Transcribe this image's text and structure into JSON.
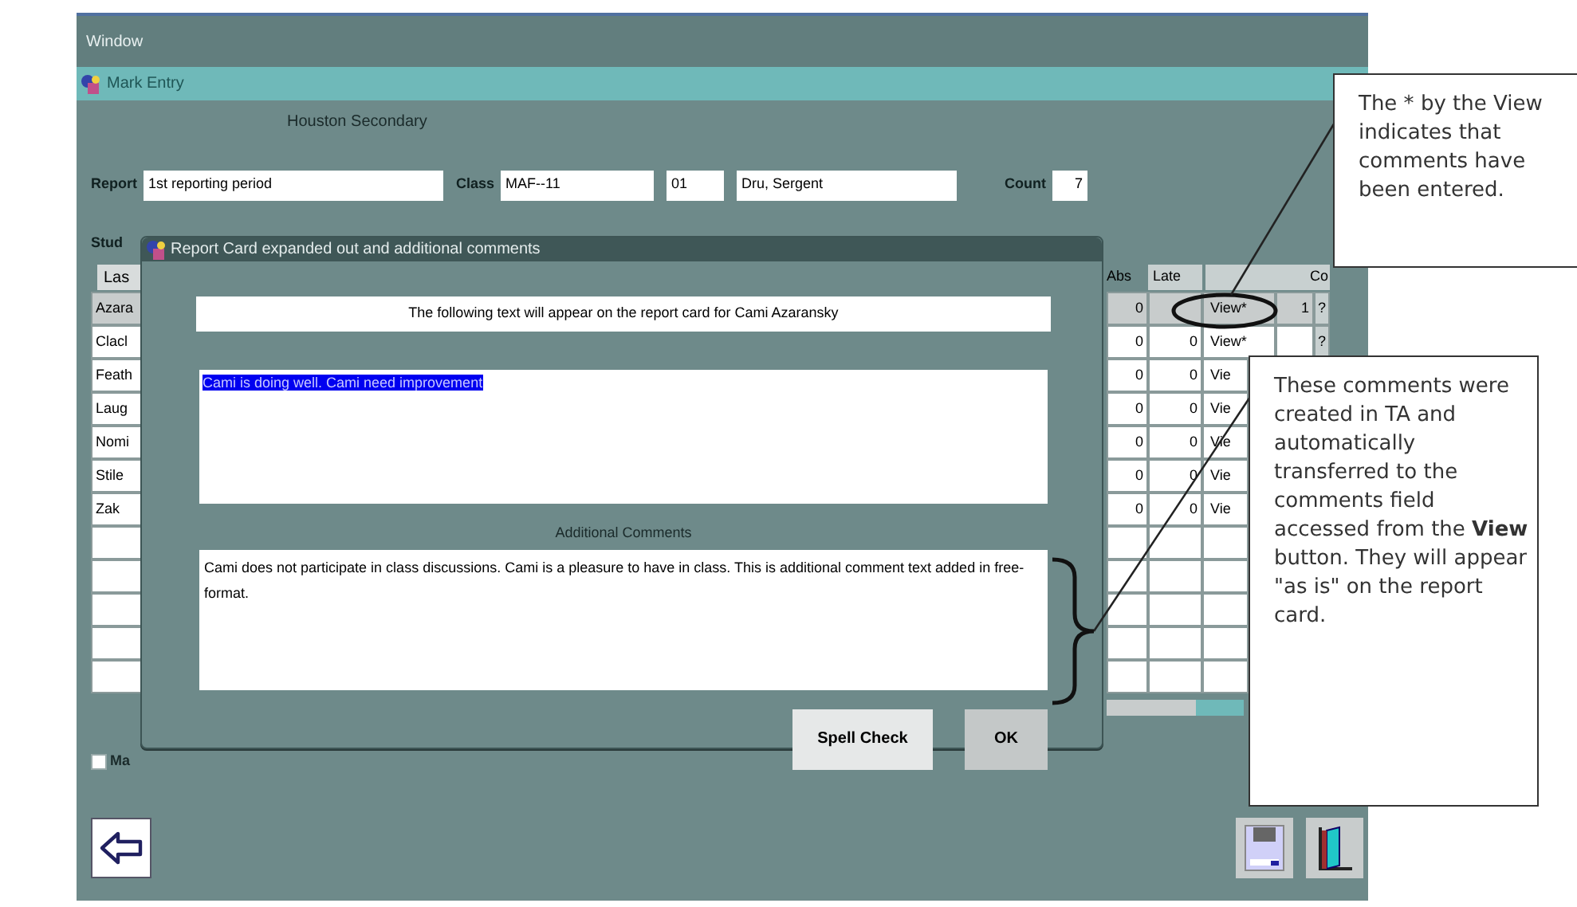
{
  "menu": [
    {
      "label": "Window"
    }
  ],
  "window": {
    "title": "Mark Entry"
  },
  "school": "Houston Secondary",
  "header_fields": [
    {
      "label": "Report",
      "value": "1st reporting period",
      "kind": "wide"
    },
    {
      "label": "Class",
      "value": "MAF--11",
      "kind": "medium"
    },
    {
      "value": "01",
      "kind": "short"
    },
    {
      "value": "Dru, Sergent",
      "kind": "long"
    },
    {
      "label": "Count",
      "value": "7",
      "kind": "number"
    }
  ],
  "table": {
    "label": "Stud",
    "left_column": "Las",
    "columns": [
      "Abs",
      "Late",
      "",
      "Co"
    ],
    "rows": [
      {
        "name": "Azara",
        "abs": "0",
        "late": "",
        "view": "View*",
        "count": "1",
        "help": "?",
        "selected": true
      },
      {
        "name": "Clacl",
        "abs": "0",
        "late": "0",
        "view": "View*",
        "count": "",
        "help": "?",
        "selected": false
      },
      {
        "name": "Feath",
        "abs": "0",
        "late": "0",
        "view": "Vie",
        "selected": false
      },
      {
        "name": "Laug",
        "abs": "0",
        "late": "0",
        "view": "Vie",
        "selected": false
      },
      {
        "name": "Nomi",
        "abs": "0",
        "late": "0",
        "view": "Vie",
        "selected": false
      },
      {
        "name": "Stile",
        "abs": "0",
        "late": "0",
        "view": "Vie",
        "selected": false
      },
      {
        "name": "Zak",
        "abs": "0",
        "late": "0",
        "view": "Vie",
        "selected": false
      },
      {
        "name": "",
        "selected": false
      },
      {
        "name": "",
        "selected": false
      },
      {
        "name": "",
        "selected": false
      },
      {
        "name": "",
        "selected": false
      },
      {
        "name": "",
        "selected": false
      }
    ]
  },
  "checkbox": {
    "label": "Ma",
    "checked": false
  },
  "dialog": {
    "title": "Report Card expanded out and additional comments",
    "heading": "The following text will appear on the report card for Cami Azaransky",
    "report_text": {
      "value": "Cami is doing well. Cami need improvement",
      "selected": true
    },
    "additional_label": "Additional Comments",
    "additional_text": "Cami does not participate in class discussions. Cami is a pleasure to have in class. This is additional comment text added in free-format.",
    "buttons": [
      {
        "label": "Spell Check",
        "kind": "light"
      },
      {
        "label": "OK",
        "kind": "dark"
      }
    ]
  },
  "callouts": [
    {
      "text": "The * by the View indicates that comments have been entered."
    },
    {
      "text": "These comments were created in TA and automatically transferred to the comments field accessed from the **View** button. They will appear \"as is\" on the report card."
    }
  ]
}
